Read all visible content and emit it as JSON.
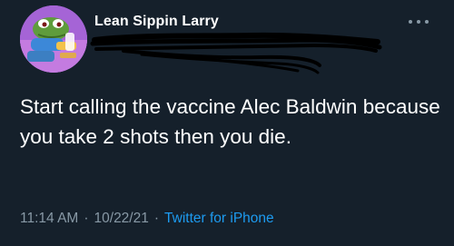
{
  "tweet": {
    "display_name": "Lean Sippin Larry",
    "text": "Start calling the vaccine Alec Baldwin because you take 2 shots then you die.",
    "time": "11:14 AM",
    "separator": "·",
    "date": "10/22/21",
    "source": "Twitter for iPhone"
  },
  "colors": {
    "background": "#15202b",
    "text": "#ffffff",
    "muted": "#8899a6",
    "link": "#1d9bf0"
  },
  "icons": {
    "more": "more-horizontal-icon",
    "avatar": "frog-avatar-image"
  }
}
